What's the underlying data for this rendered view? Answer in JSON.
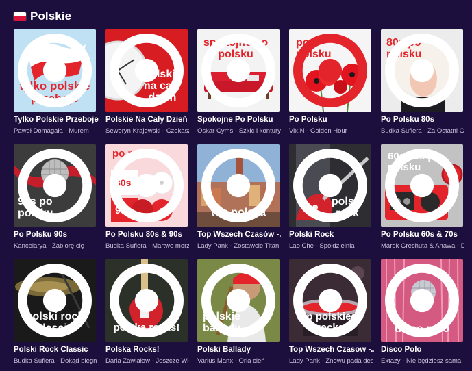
{
  "section": {
    "title": "Polskie",
    "flag_icon": "poland-flag-icon"
  },
  "tiles": [
    {
      "name": "Tylko Polskie Przeboje",
      "sub": "Paweł Domagała - Murem",
      "cover_text": "tylko polskie przeboje",
      "accent": "#e3242b"
    },
    {
      "name": "Polskie Na Cały Dzień",
      "sub": "Seweryn Krajewski - Czekasz",
      "cover_text": "polskie na cały dzień",
      "accent": "#d71d22"
    },
    {
      "name": "Spokojne Po Polsku",
      "sub": "Oskar Cyms - Szkic i kontury",
      "cover_text": "spokojne po polsku",
      "accent": "#e3242b"
    },
    {
      "name": "Po Polsku",
      "sub": "Vix.N - Golden Hour",
      "cover_text": "po polsku",
      "accent": "#e3242b"
    },
    {
      "name": "Po Polsku 80s",
      "sub": "Budka Suflera - Za Ostatni Grosz",
      "cover_text": "80s po polsku",
      "accent": "#e3242b"
    },
    {
      "name": "Po Polsku 90s",
      "sub": "Kancelarya - Zabiorę cię",
      "cover_text": "90s po polsku",
      "accent": "#c41e2a"
    },
    {
      "name": "Po Polsku 80s & 90s",
      "sub": "Budka Suflera - Martwe morze",
      "cover_text": "po polsku",
      "badge_a": "80s",
      "badge_b": "90s",
      "accent": "#e3242b"
    },
    {
      "name": "Top Wszech Czasów -...",
      "sub": "Lady Pank - Zostawcie Titanica",
      "cover_text": "top polska",
      "accent": "#e3242b"
    },
    {
      "name": "Polski Rock",
      "sub": "Lao Che - Spółdzielnia",
      "cover_text": "polski rock",
      "accent": "#e3242b"
    },
    {
      "name": "Po Polsku 60s & 70s",
      "sub": "Marek Grechuta & Anawa - Dni",
      "cover_text": "60s 70s po polsku",
      "accent": "#e3242b"
    },
    {
      "name": "Polski Rock Classic",
      "sub": "Budka Suflera - Dokąd biegniesz",
      "cover_text": "polski rock classic",
      "accent": "#e3242b"
    },
    {
      "name": "Polska Rocks!",
      "sub": "Daria Zawiałow - Jeszcze Wiele",
      "cover_text": "polska rocks!",
      "accent": "#e3242b"
    },
    {
      "name": "Polski Ballady",
      "sub": "Varius Manx - Orła cień",
      "cover_text": "polskie ballady",
      "accent": "#e3242b"
    },
    {
      "name": "Top Wszech Czasow -...",
      "sub": "Lady Pank - Znowu pada deszcz",
      "cover_text": "top polskiego rocka",
      "accent": "#e3242b"
    },
    {
      "name": "Disco Polo",
      "sub": "Extazy - Nie będziesz sama",
      "cover_text": "disco polo",
      "accent": "#e3242b"
    }
  ]
}
